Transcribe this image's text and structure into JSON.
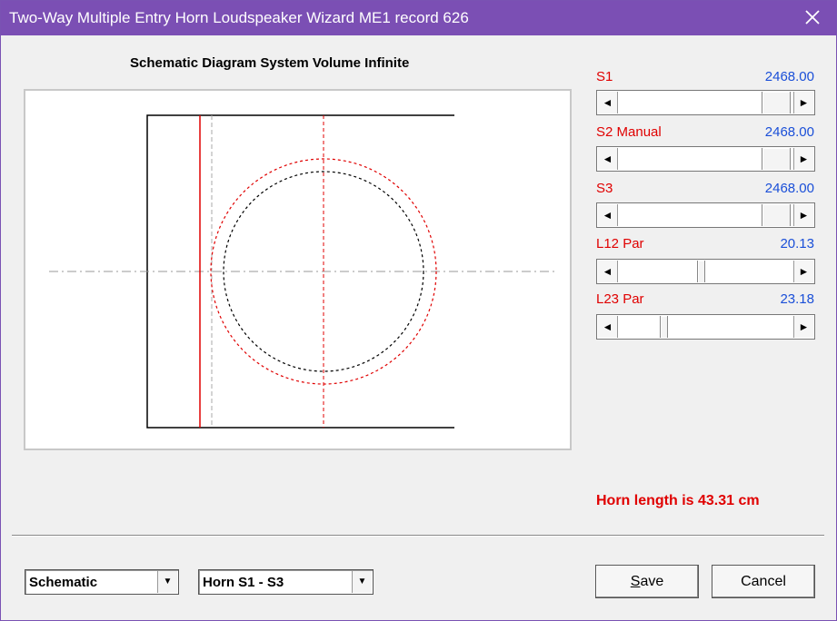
{
  "window": {
    "title": "Two-Way Multiple Entry Horn Loudspeaker Wizard   ME1 record 626",
    "close_glyph": "✕"
  },
  "diagram": {
    "title": "Schematic Diagram   System Volume Infinite"
  },
  "parameters": [
    {
      "label": "S1",
      "value": "2468.00",
      "position": 0.93
    },
    {
      "label": "S2  Manual",
      "value": "2468.00",
      "position": 0.93
    },
    {
      "label": "S3",
      "value": "2468.00",
      "position": 0.93
    },
    {
      "label": "L12  Par",
      "value": "20.13",
      "position": 0.47
    },
    {
      "label": "L23  Par",
      "value": "23.18",
      "position": 0.24
    }
  ],
  "scroll": {
    "left_arrow": "◄",
    "right_arrow": "►"
  },
  "status": {
    "horn_length": "Horn length is 43.31 cm"
  },
  "controls": {
    "view_select": {
      "value": "Schematic",
      "arrow": "▼"
    },
    "range_select": {
      "value": "Horn S1 - S3",
      "arrow": "▼"
    },
    "save_accel": "S",
    "save_rest": "ave",
    "cancel_label": "Cancel"
  },
  "colors": {
    "title_bar": "#7b4fb4",
    "label_red": "#e00000",
    "value_blue": "#1a4fd8"
  }
}
